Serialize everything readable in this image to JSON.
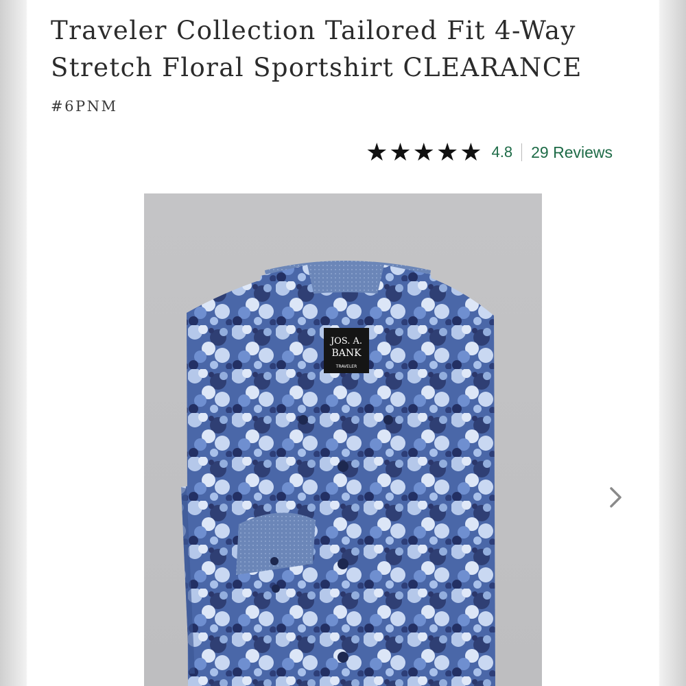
{
  "product": {
    "title": "Traveler Collection Tailored Fit 4-Way Stretch Floral Sportshirt CLEARANCE",
    "sku": "#6PNM",
    "rating": {
      "stars_total": 5,
      "stars_filled": 5,
      "value": "4.8",
      "reviews_label": "29 Reviews"
    },
    "image": {
      "label_line1": "JOS. A.",
      "label_line2": "BANK",
      "label_line3": "TRAVELER"
    }
  },
  "icons": {
    "star": "star-icon",
    "next": "chevron-right-icon"
  },
  "colors": {
    "accent_green": "#1e6b47",
    "star": "#111111",
    "shirt_blue": "#4a67a8",
    "image_background": "#c4c4c6"
  }
}
